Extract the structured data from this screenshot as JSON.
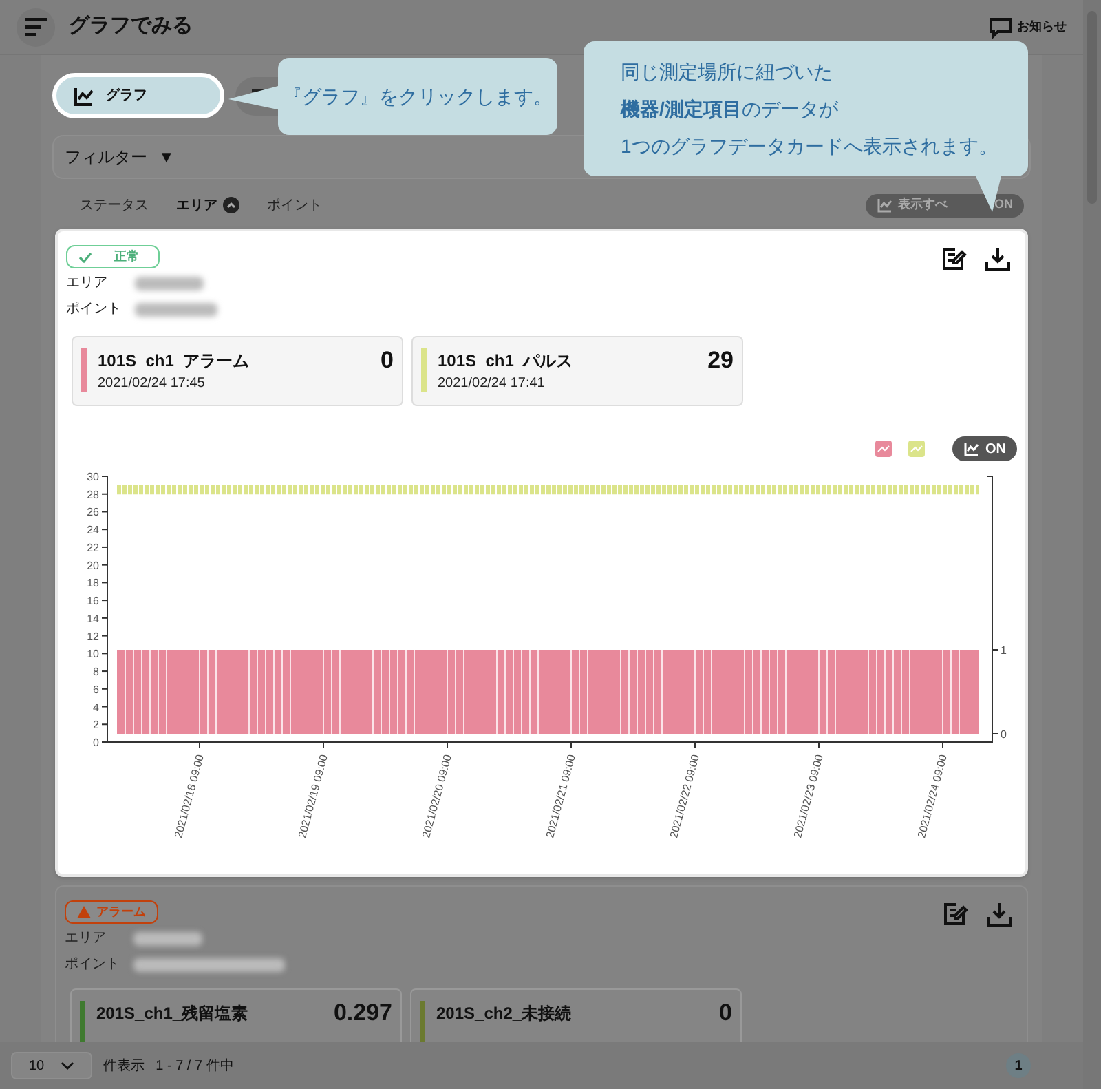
{
  "header": {
    "title": "グラフでみる",
    "notice": "お知らせ"
  },
  "view_tabs": [
    {
      "label": "グラフ",
      "kind": "graph",
      "selected": true
    },
    {
      "kind": "list",
      "selected": false
    }
  ],
  "callouts": [
    {
      "text": "『グラフ』をクリックします。",
      "kind": "left"
    },
    {
      "lines": [
        "同じ測定場所に紐づいた",
        "**機器/測定項目**のデータが",
        "1つのグラフデータカードへ表示されます。"
      ],
      "kind": "down"
    }
  ],
  "filter": {
    "label": "フィルター",
    "arrow": "▼"
  },
  "sort": [
    {
      "label": "ステータス",
      "selected": false
    },
    {
      "label": "エリア",
      "selected": true
    },
    {
      "label": "ポイント",
      "selected": false
    }
  ],
  "show_all": {
    "label_start": "表示すべ",
    "label_end": "ON"
  },
  "cards": [
    {
      "highlighted": true,
      "status": {
        "label": "正常",
        "kind": "normal"
      },
      "area_label": "エリア",
      "point_label": "ポイント",
      "sensors": [
        {
          "name": "101S_ch1_アラーム",
          "time": "2021/02/24 17:45",
          "value": "0",
          "color": "#e8899b"
        },
        {
          "name": "101S_ch1_パルス",
          "time": "2021/02/24 17:41",
          "value": "29",
          "color": "#dbe48a"
        }
      ],
      "graph_toggle": "ON",
      "chart": {
        "legend": [
          {
            "color": "#e8899b"
          },
          {
            "color": "#dbe48a"
          }
        ],
        "y_tick_labels": [
          "30",
          "28",
          "26",
          "24",
          "22",
          "20",
          "18",
          "16",
          "14",
          "12",
          "10",
          "8",
          "6",
          "4",
          "2",
          "0"
        ],
        "y2_tick_labels": [
          "1",
          "0"
        ],
        "x_tick_labels": [
          "2021/02/18 09:00",
          "2021/02/19 09:00",
          "2021/02/20 09:00",
          "2021/02/21 09:00",
          "2021/02/22 09:00",
          "2021/02/23 09:00",
          "2021/02/24 09:00"
        ]
      }
    },
    {
      "highlighted": false,
      "status": {
        "label": "アラーム",
        "kind": "alarm"
      },
      "area_label": "エリア",
      "point_label": "ポイント",
      "sensors": [
        {
          "name": "201S_ch1_残留塩素",
          "value": "0.297",
          "color": "#3f7a2f"
        },
        {
          "name": "201S_ch2_未接続",
          "value": "0",
          "color": "#6b7a2f"
        }
      ]
    }
  ],
  "footer": {
    "page_size": "10",
    "page_size_label": "件表示",
    "range": "1 - 7 / 7 件中",
    "pages": [
      {
        "label": "1",
        "selected": true
      }
    ]
  }
}
